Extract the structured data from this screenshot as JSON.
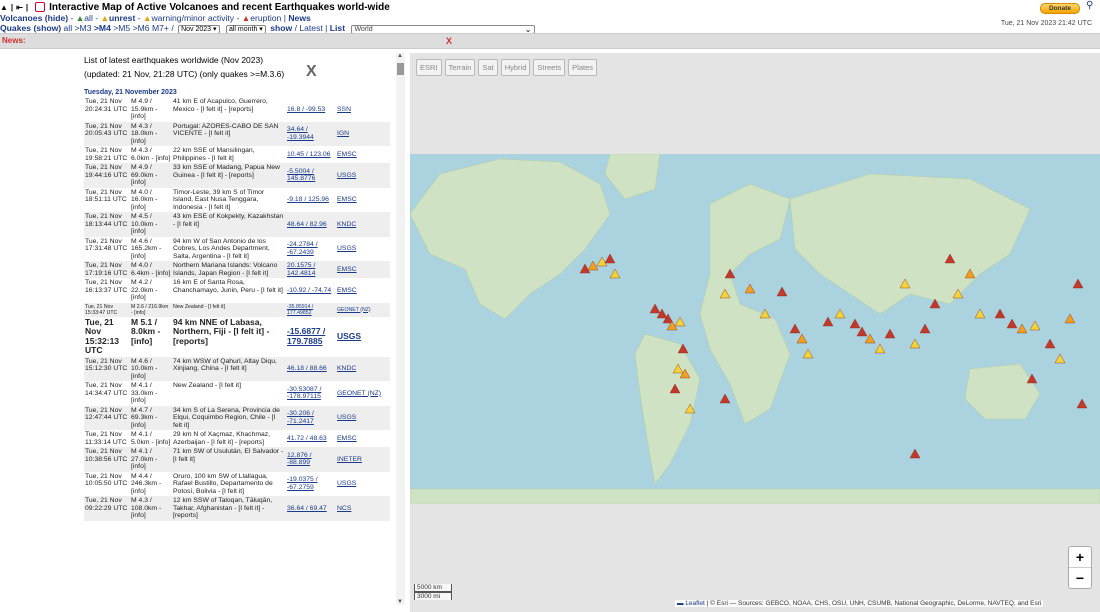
{
  "header": {
    "title": "Interactive Map of Active Volcanoes and recent Earthquakes world-wide",
    "volcanoes_label": "Volcanoes (hide)",
    "v_all": "all",
    "v_unrest": "unrest",
    "v_warning": "warning/minor activity",
    "v_eruption": "eruption",
    "news_link": "News",
    "quakes_label": "Quakes (show)",
    "q_all": "all",
    "q_m3": ">M3",
    "q_m4": ">M4",
    "q_m5": ">M5",
    "q_m6": ">M6",
    "q_m7": "M7+",
    "month_select": "Nov 2023",
    "period_select": "all month",
    "show_label": "show",
    "latest_label": "Latest",
    "list_label": "List",
    "region_select": "World",
    "donate_label": "Donate",
    "datetime": "Tue, 21 Nov 2023 21:42 UTC"
  },
  "news": {
    "label": "News:",
    "close": "X"
  },
  "list": {
    "title": "List of latest earthquakes worldwide (Nov 2023)",
    "subtitle": "(updated: 21 Nov, 21:28 UTC) (only quakes >=M.3.6)",
    "close": "X",
    "day_header": "Tuesday, 21 November 2023",
    "rows": [
      {
        "time": "Tue, 21 Nov 20:24:31 UTC",
        "mag": "M 4.9 / 15.9km - [info]",
        "loc": "41 km E of Acapulco, Guerrero, Mexico - [I felt it] - [reports]",
        "coords": "16.8 / -99.53",
        "src": "SSN"
      },
      {
        "time": "Tue, 21 Nov 20:05:43 UTC",
        "mag": "M 4.3 / 18.0km - [info]",
        "loc": "Portugal: AZORES-CABO DE SAN VICENTE - [I felt it]",
        "coords": "34.64 / -19.3944",
        "src": "IGN"
      },
      {
        "time": "Tue, 21 Nov 19:58:21 UTC",
        "mag": "M 4.3 / 6.0km - [info]",
        "loc": "22 km SSE of Mansilingan, Philippines - [I felt it]",
        "coords": "10.45 / 123.06",
        "src": "EMSC"
      },
      {
        "time": "Tue, 21 Nov 19:44:16 UTC",
        "mag": "M 4.9 / 69.0km - [info]",
        "loc": "33 km SSE of Madang, Papua New Guinea - [I felt it] - [reports]",
        "coords": "-5.5004 / 145.8776",
        "src": "USGS"
      },
      {
        "time": "Tue, 21 Nov 18:51:11 UTC",
        "mag": "M 4.0 / 16.0km - [info]",
        "loc": "Timor-Leste, 39 km S of Timor Island, East Nusa Tenggara, Indonesia - [I felt it]",
        "coords": "-9.18 / 125.96",
        "src": "EMSC"
      },
      {
        "time": "Tue, 21 Nov 18:13:44 UTC",
        "mag": "M 4.5 / 10.0km - [info]",
        "loc": "43 km ESE of Kokpekty, Kazakhstan - [I felt it]",
        "coords": "48.64 / 82.96",
        "src": "KNDC"
      },
      {
        "time": "Tue, 21 Nov 17:31:48 UTC",
        "mag": "M 4.6 / 165.2km - [info]",
        "loc": "94 km W of San Antonio de los Cobres, Los Andes Department, Salta, Argentina - [I felt it]",
        "coords": "-24.2784 / -67.2439",
        "src": "USGS"
      },
      {
        "time": "Tue, 21 Nov 17:19:16 UTC",
        "mag": "M 4.0 / 6.4km - [info]",
        "loc": "Northern Mariana Islands: Volcano Islands, Japan Region - [I felt it]",
        "coords": "20.1575 / 142.4814",
        "src": "EMSC"
      },
      {
        "time": "Tue, 21 Nov 16:13:37 UTC",
        "mag": "M 4.2 / 22.0km - [info]",
        "loc": "16 km E of Santa Rosa, Chanchamayo, Junin, Peru - [I felt it]",
        "coords": "-10.92 / -74.74",
        "src": "EMSC"
      },
      {
        "time": "Tue, 21 Nov 15:33:47 UTC",
        "mag": "M 2.6 / 216.9km - [info]",
        "loc": "New Zealand - [I felt it]",
        "coords": "-35.85914 / 177.49852",
        "src": "GEONET (NZ)",
        "size": "small"
      },
      {
        "time": "Tue, 21 Nov 15:32:13 UTC",
        "mag": "M 5.1 / 8.0km - [info]",
        "loc": "94 km NNE of Labasa, Northern, Fiji - [I felt it] - [reports]",
        "coords": "-15.6877 / 179.7885",
        "src": "USGS",
        "size": "big"
      },
      {
        "time": "Tue, 21 Nov 15:12:30 UTC",
        "mag": "M 4.6 / 10.0km - [info]",
        "loc": "74 km WSW of Qahurl, Altay Diqu, Xinjiang, China - [I felt it]",
        "coords": "46.18 / 88.66",
        "src": "KNDC"
      },
      {
        "time": "Tue, 21 Nov 14:34:47 UTC",
        "mag": "M 4.1 / 33.0km - [info]",
        "loc": "New Zealand - [I felt it]",
        "coords": "-30.53087 / -178.97115",
        "src": "GEONET (NZ)"
      },
      {
        "time": "Tue, 21 Nov 12:47:44 UTC",
        "mag": "M 4.7 / 69.3km - [info]",
        "loc": "34 km S of La Serena, Provincia de Elqui, Coquimbo Region, Chile - [I felt it]",
        "coords": "-30.206 / -71.2417",
        "src": "USGS"
      },
      {
        "time": "Tue, 21 Nov 11:33:14 UTC",
        "mag": "M 4.1 / 5.0km - [info]",
        "loc": "29 km N of Xaçmaz, Khachmaz, Azerbaijan - [I felt it] - [reports]",
        "coords": "41.72 / 48.63",
        "src": "EMSC"
      },
      {
        "time": "Tue, 21 Nov 10:38:56 UTC",
        "mag": "M 4.1 / 27.0km - [info]",
        "loc": "71 km SW of Usulután, El Salvador - [I felt it]",
        "coords": "12.876 / -88.899",
        "src": "INETER"
      },
      {
        "time": "Tue, 21 Nov 10:05:50 UTC",
        "mag": "M 4.4 / 246.3km - [info]",
        "loc": "Oruro, 100 km SW of Llallagua, Rafael Bustillo, Departamento de Potosí, Bolivia - [I felt it]",
        "coords": "-19.0375 / -67.2759",
        "src": "USGS"
      },
      {
        "time": "Tue, 21 Nov 09:22:29 UTC",
        "mag": "M 4.3 / 108.0km - [info]",
        "loc": "12 km SSW of Taloqan, Tāluqān, Takhar, Afghanistan - [I felt it] - [reports]",
        "coords": "36.64 / 69.47",
        "src": "NCS"
      }
    ]
  },
  "map": {
    "tools": [
      "ESRI",
      "Terrain",
      "Sat",
      "Hybrid",
      "Streets",
      "Plates"
    ],
    "zoom_in": "+",
    "zoom_out": "−",
    "scale_km": "5000 km",
    "scale_mi": "3000 mi",
    "attribution_leaflet": "Leaflet",
    "attribution_text": "| © Esri — Sources: GEBCO, NOAA, CHS, OSU, UNH, CSUMB, National Geographic, DeLorme, NAVTEQ, and Esri",
    "ocean_color": "#aad3df",
    "land_color": "#cfe3c4",
    "eruption_color": "#c0392b",
    "warning_color": "#f0a020",
    "unrest_color": "#f3d23a"
  }
}
